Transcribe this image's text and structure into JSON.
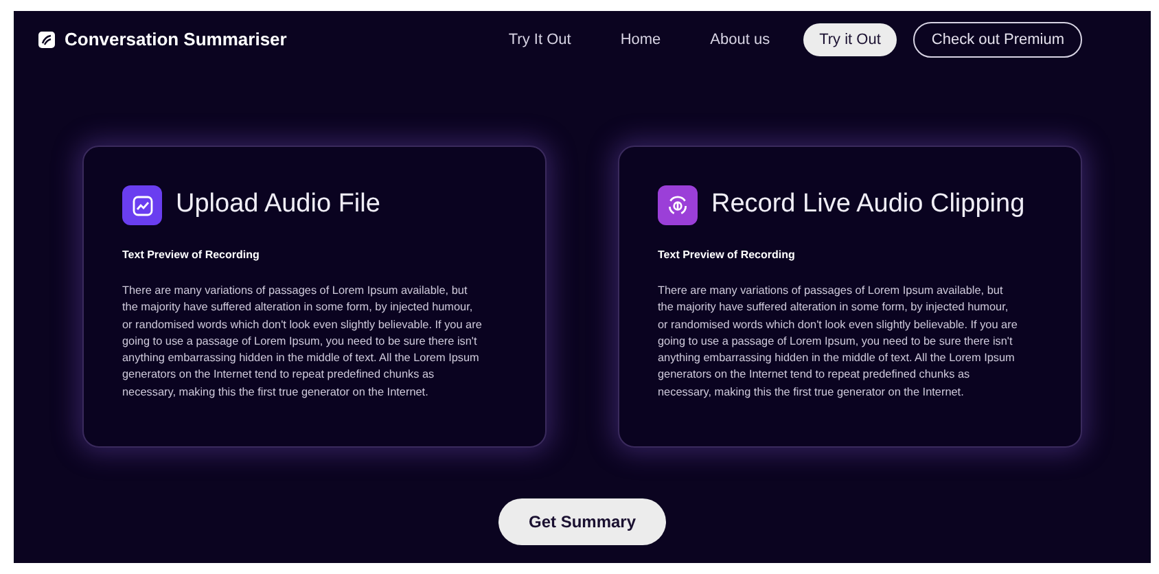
{
  "brand": {
    "name": "Conversation Summariser"
  },
  "nav": [
    {
      "label": "Try It Out",
      "kind": "link"
    },
    {
      "label": "Home",
      "kind": "link"
    },
    {
      "label": "About us",
      "kind": "link"
    },
    {
      "label": "Try it Out",
      "kind": "pill"
    },
    {
      "label": "Check out Premium",
      "kind": "outline"
    }
  ],
  "cards": [
    {
      "title": "Upload Audio File",
      "kind": "upload",
      "subtitle": "Text Preview of Recording",
      "text": "There are many variations of passages of Lorem Ipsum available, but the majority have suffered alteration in some form, by injected humour, or randomised words which don't look even slightly believable. If you are going to use a passage of Lorem Ipsum, you need to be sure there isn't anything embarrassing hidden in the middle of text. All the Lorem Ipsum generators on the Internet tend to repeat predefined chunks as necessary, making this the first true generator on the Internet."
    },
    {
      "title": "Record Live Audio Clipping",
      "kind": "record",
      "subtitle": "Text Preview of Recording",
      "text": "There are many variations of passages of Lorem Ipsum available, but the majority have suffered alteration in some form, by injected humour, or randomised words which don't look even slightly believable. If you are going to use a passage of Lorem Ipsum, you need to be sure there isn't anything embarrassing hidden in the middle of text. All the Lorem Ipsum generators on the Internet tend to repeat predefined chunks as necessary, making this the first true generator on the Internet."
    }
  ],
  "action": {
    "label": "Get Summary"
  }
}
